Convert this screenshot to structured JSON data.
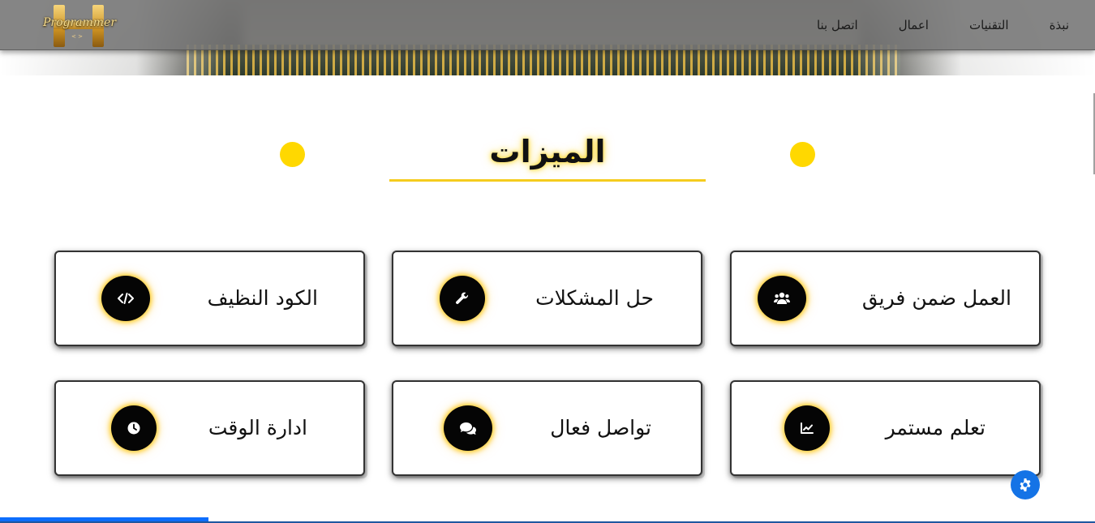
{
  "brand": {
    "logo_text": "Programmer",
    "logo_sub": "< >"
  },
  "nav": {
    "items": [
      "نبذة",
      "التقنيات",
      "اعمال",
      "اتصل بنا"
    ]
  },
  "section": {
    "title": "الميزات"
  },
  "features": [
    {
      "label": "العمل ضمن فريق",
      "icon": "users-icon"
    },
    {
      "label": "حل المشكلات",
      "icon": "wrench-icon"
    },
    {
      "label": "الكود النظيف",
      "icon": "code-icon"
    },
    {
      "label": "تعلم مستمر",
      "icon": "chart-line-icon"
    },
    {
      "label": "تواصل فعال",
      "icon": "comments-icon"
    },
    {
      "label": "ادارة الوقت",
      "icon": "clock-icon"
    }
  ],
  "colors": {
    "accent_yellow": "#ffd800",
    "settings_blue": "#1473e6",
    "progress_blue": "#0d6efd"
  },
  "scroll_progress_fraction": 0.19
}
